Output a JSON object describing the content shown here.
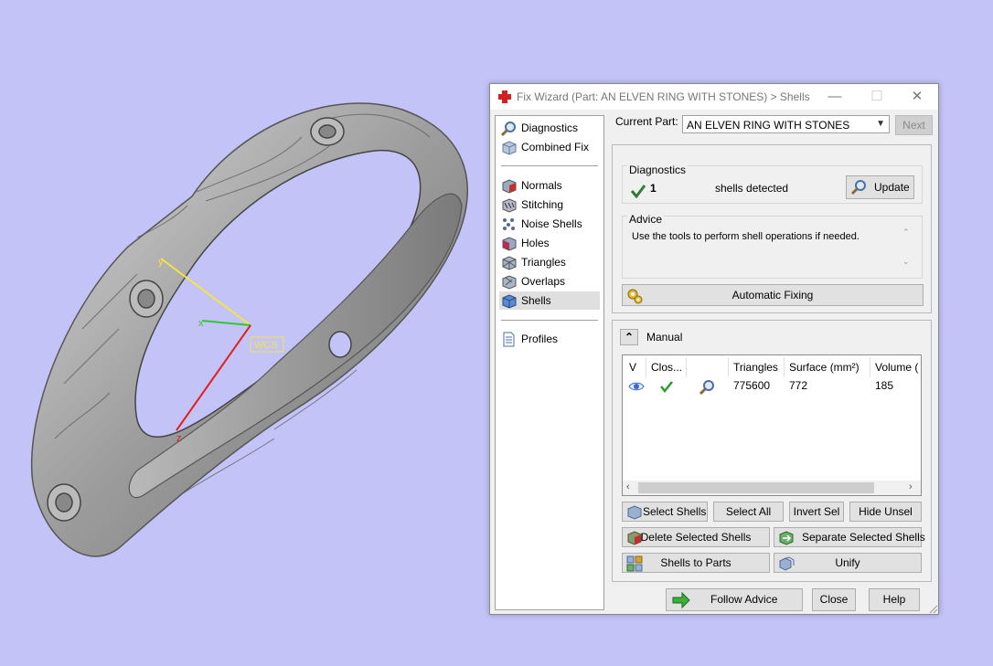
{
  "viewport": {
    "axis_labels": {
      "x": "x",
      "y": "y",
      "z": "z"
    },
    "wcs_label": "WCS"
  },
  "dialog": {
    "title": "Fix Wizard (Part: AN ELVEN RING WITH STONES) > Shells",
    "window_buttons": {
      "minimize": "—",
      "maximize": "☐",
      "close": "✕"
    }
  },
  "nav": {
    "items": [
      {
        "label": "Diagnostics",
        "icon": "magnifier-icon"
      },
      {
        "label": "Combined Fix",
        "icon": "cube-icon"
      },
      {
        "label": "Normals",
        "icon": "normals-cube-icon"
      },
      {
        "label": "Stitching",
        "icon": "stitching-cube-icon"
      },
      {
        "label": "Noise Shells",
        "icon": "noise-shells-icon"
      },
      {
        "label": "Holes",
        "icon": "holes-cube-icon"
      },
      {
        "label": "Triangles",
        "icon": "triangles-cube-icon"
      },
      {
        "label": "Overlaps",
        "icon": "overlaps-cube-icon"
      },
      {
        "label": "Shells",
        "icon": "shells-cube-icon",
        "selected": true
      },
      {
        "label": "Profiles",
        "icon": "document-icon"
      }
    ]
  },
  "current_part": {
    "label": "Current Part:",
    "value": "AN ELVEN RING WITH STONES",
    "next_label": "Next"
  },
  "diagnostics": {
    "title": "Diagnostics",
    "count": "1",
    "text": "shells detected",
    "update_label": "Update",
    "status_color": "#2e7d32"
  },
  "advice": {
    "title": "Advice",
    "text": "Use the tools to perform shell operations if needed."
  },
  "automatic_fixing_label": "Automatic Fixing",
  "manual": {
    "label": "Manual",
    "columns": [
      "V",
      "Clos...",
      "",
      "Triangles",
      "Surface (mm²)",
      "Volume ("
    ],
    "rows": [
      {
        "visible_icon": "eye-icon",
        "closed_icon": "checkmark-icon",
        "zoom_icon": "magnifier-icon",
        "triangles": "775600",
        "surface": "772",
        "volume": "185"
      }
    ]
  },
  "buttons": {
    "select_shells": "Select Shells",
    "select_all": "Select All",
    "invert_sel": "Invert Sel",
    "hide_unsel": "Hide Unsel",
    "delete_selected_shells": "Delete Selected Shells",
    "separate_selected_shells": "Separate Selected Shells",
    "shells_to_parts": "Shells to Parts",
    "unify": "Unify",
    "follow_advice": "Follow Advice",
    "close": "Close",
    "help": "Help"
  },
  "colors": {
    "background": "#c4c3f7",
    "accent_green": "#2e9d2e",
    "app_icon_red": "#d32020"
  }
}
